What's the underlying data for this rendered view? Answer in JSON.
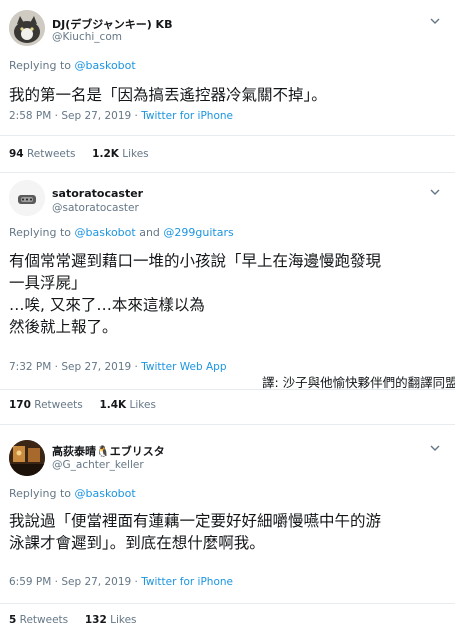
{
  "tweets": [
    {
      "name": "DJ(デブジャンキー) KB",
      "handle": "@Kiuchi_com",
      "reply_prefix": "Replying to ",
      "reply_to": "@baskobot",
      "reply_to_2": "",
      "text": [
        "我的第一名是「因為搞丟遙控器冷氣關不掉」。"
      ],
      "time": "2:58 PM · Sep 27, 2019 · ",
      "source": "Twitter for iPhone",
      "retweets": "94",
      "retweets_label": " Retweets",
      "likes": "1.2K",
      "likes_label": " Likes"
    },
    {
      "name": "satoratocaster",
      "handle": "@satoratocaster",
      "reply_prefix": "Replying to ",
      "reply_to": "@baskobot",
      "reply_and": " and ",
      "reply_to_2": "@299guitars",
      "text": [
        "有個常常遲到藉口一堆的小孩說「早上在海邊慢跑發現",
        "一具浮屍」",
        "…唉, 又來了…本來這樣以為",
        "然後就上報了。"
      ],
      "time": "7:32 PM · Sep 27, 2019 · ",
      "source": "Twitter Web App",
      "retweets": "170",
      "retweets_label": " Retweets",
      "likes": "1.4K",
      "likes_label": " Likes"
    },
    {
      "name": "高荻泰晴🐧エブリスタ",
      "handle": "@G_achter_keller",
      "reply_prefix": "Replying to ",
      "reply_to": "@baskobot",
      "reply_to_2": "",
      "text": [
        "我說過「便當裡面有蓮藕一定要好好細嚼慢嚥中午的游",
        "泳課才會遲到」。到底在想什麼啊我。"
      ],
      "time": "6:59 PM · Sep 27, 2019 · ",
      "source": "Twitter for iPhone",
      "retweets": "5",
      "retweets_label": " Retweets",
      "likes": "132",
      "likes_label": " Likes"
    }
  ],
  "credit": "譯: 沙子與他愉快夥伴們的翻譯同盟"
}
